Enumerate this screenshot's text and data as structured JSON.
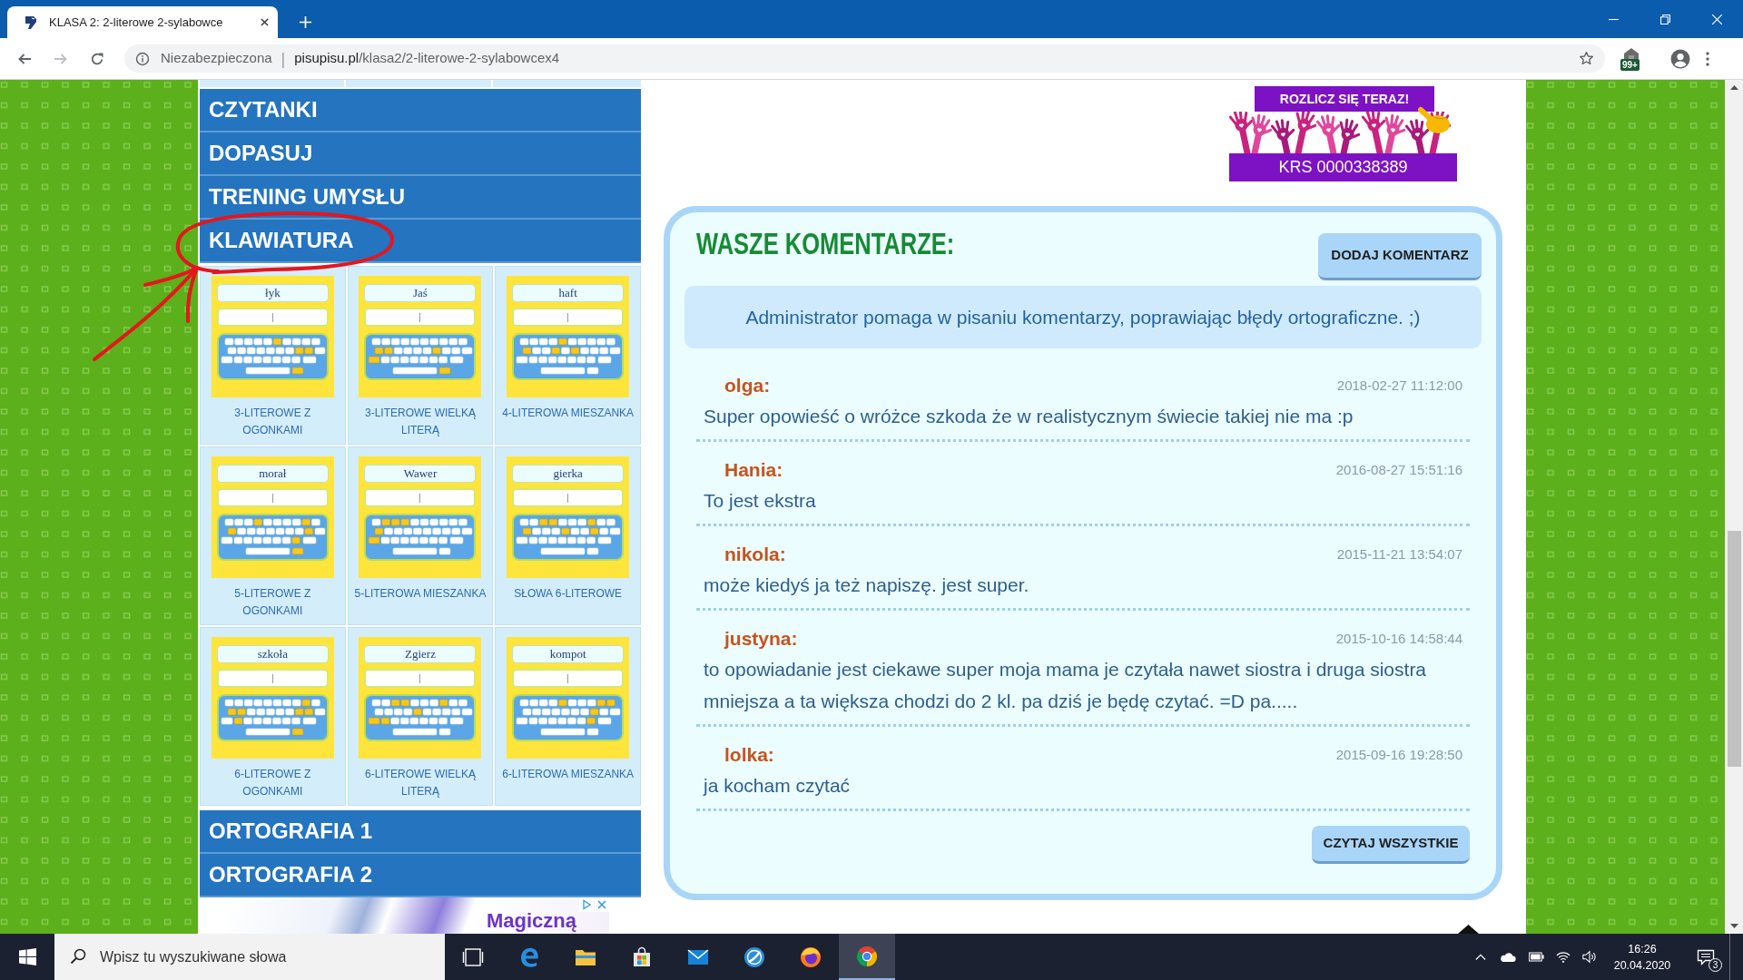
{
  "browser": {
    "tab": {
      "title": "KLASA 2: 2-literowe 2-sylabowce"
    },
    "toolbar": {
      "buttons": [
        {
          "kind": "back",
          "disabled": false
        },
        {
          "kind": "forward",
          "disabled": true
        },
        {
          "kind": "reload",
          "disabled": false
        }
      ]
    },
    "address_bar": {
      "security": "Niezabezpieczona",
      "separator": "|",
      "host": "pisupisu.pl",
      "path": "/klasa2/2-literowe-2-sylabowcex4"
    },
    "extension_badge": "99+"
  },
  "menu_top": [
    {
      "label": "CZYTANKI"
    },
    {
      "label": "DOPASUJ"
    },
    {
      "label": "TRENING UMYSŁU"
    },
    {
      "label": "KLAWIATURA"
    }
  ],
  "tiles": [
    {
      "word": "łyk",
      "label": "3-LITEROWE Z OGONKAMI"
    },
    {
      "word": "Jaś",
      "label": "3-LITEROWE WIELKĄ LITERĄ"
    },
    {
      "word": "haft",
      "label": "4-LITEROWA MIESZANKA"
    },
    {
      "word": "morał",
      "label": "5-LITEROWE Z OGONKAMI"
    },
    {
      "word": "Wawer",
      "label": "5-LITEROWA MIESZANKA"
    },
    {
      "word": "gierka",
      "label": "SŁOWA 6-LITEROWE"
    },
    {
      "word": "szkoła",
      "label": "6-LITEROWE Z OGONKAMI"
    },
    {
      "word": "Zgierz",
      "label": "6-LITEROWE WIELKĄ LITERĄ"
    },
    {
      "word": "kompot",
      "label": "6-LITEROWA MIESZANKA"
    }
  ],
  "menu_bottom": [
    {
      "label": "ORTOGRAFIA 1"
    },
    {
      "label": "ORTOGRAFIA 2"
    }
  ],
  "bottom_ad": {
    "text": "Magiczną"
  },
  "top_ad": {
    "headline": "ROZLICZ SIĘ TERAZ!",
    "caption": "KRS 0000338389"
  },
  "comments": {
    "title": "WASZE KOMENTARZE:",
    "add_button": "DODAJ KOMENTARZ",
    "notice": "Administrator pomaga w pisaniu komentarzy, poprawiając błędy ortograficzne. ;)",
    "items": [
      {
        "author": "olga:",
        "date": "2018-02-27 11:12:00",
        "text": "Super opowieść o wróżce szkoda że w realistycznym świecie takiej nie ma :p"
      },
      {
        "author": "Hania:",
        "date": "2016-08-27 15:51:16",
        "text": "To jest ekstra"
      },
      {
        "author": "nikola:",
        "date": "2015-11-21 13:54:07",
        "text": "może kiedyś ja też napiszę. jest super."
      },
      {
        "author": "justyna:",
        "date": "2015-10-16 14:58:44",
        "text": "to opowiadanie jest ciekawe super moja mama je czytała nawet siostra i druga siostra mniejsza a ta większa chodzi do 2 kl. pa dziś je będę czytać. =D pa....."
      },
      {
        "author": "lolka:",
        "date": "2015-09-16 19:28:50",
        "text": "ja kocham czytać"
      }
    ],
    "read_all_button": "CZYTAJ WSZYSTKIE"
  },
  "taskbar": {
    "search": {
      "placeholder": "Wpisz tu wyszukiwane słowa"
    },
    "apps": [
      {
        "kind": "task-view",
        "selected": false
      },
      {
        "kind": "edge",
        "selected": false
      },
      {
        "kind": "explorer",
        "selected": false
      },
      {
        "kind": "store",
        "selected": false
      },
      {
        "kind": "mail",
        "selected": false
      },
      {
        "kind": "app",
        "selected": false
      },
      {
        "kind": "firefox",
        "selected": false
      },
      {
        "kind": "chrome",
        "selected": true
      }
    ],
    "time": "16:26",
    "date": "20.04.2020",
    "notification_count": "3"
  }
}
